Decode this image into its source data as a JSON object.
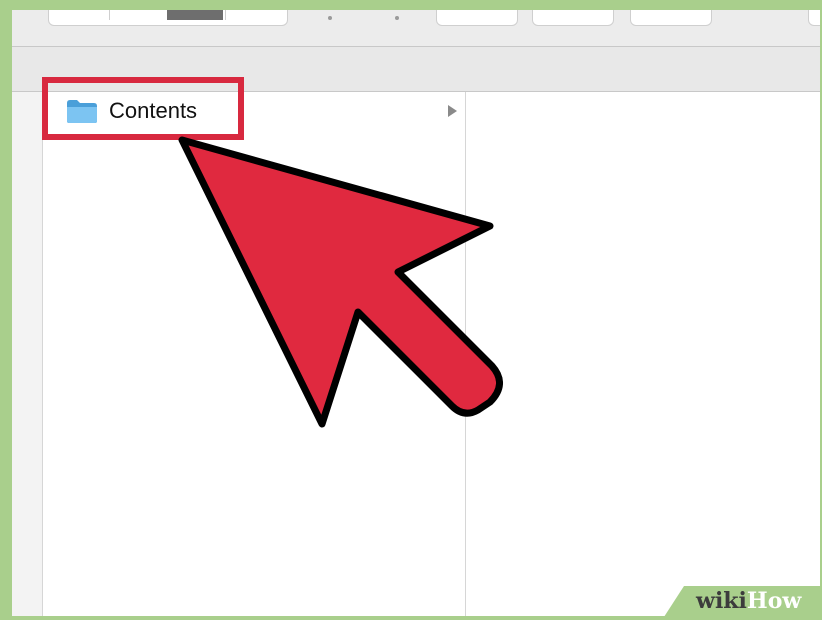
{
  "finder": {
    "toolbar": {
      "buttons": [
        "view-options",
        "arrange",
        "action",
        "share",
        "tags"
      ],
      "ellipsis": "•••"
    },
    "column1": {
      "items": [
        {
          "label": "Contents",
          "icon": "folder-icon",
          "has_children": true,
          "highlighted": true
        }
      ]
    }
  },
  "annotation": {
    "highlight_color": "#d8293f",
    "arrow_color": "#e0293f",
    "arrow_outline": "#000000"
  },
  "watermark": {
    "part1": "wiki",
    "part2": "How"
  },
  "colors": {
    "frame_border": "#a9cf8c",
    "toolbar_bg": "#ececec",
    "folder_blue": "#67b6ea"
  }
}
